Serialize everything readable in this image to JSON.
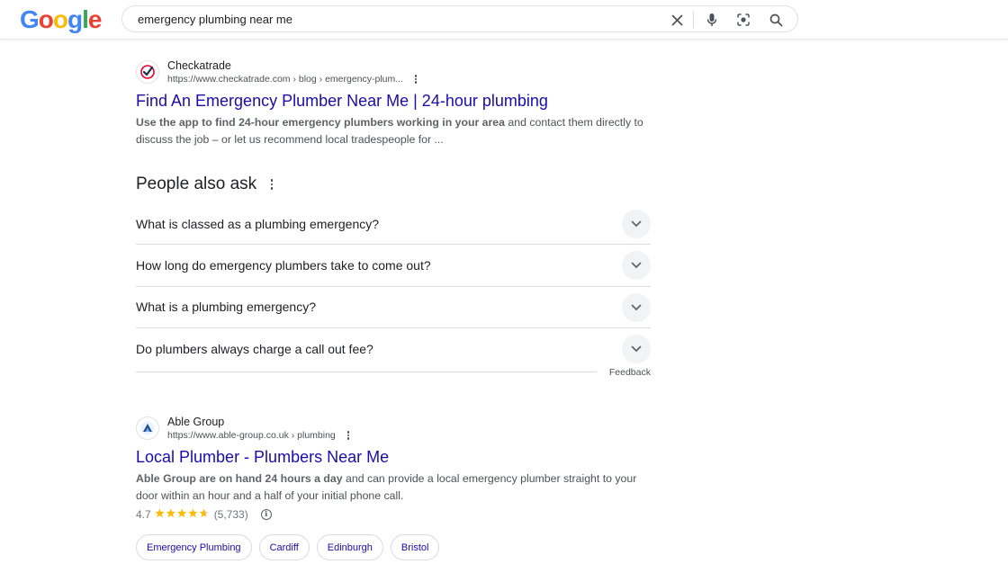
{
  "header": {
    "logo_letters": [
      {
        "ch": "G",
        "color": "#4285F4"
      },
      {
        "ch": "o",
        "color": "#EA4335"
      },
      {
        "ch": "o",
        "color": "#FBBC05"
      },
      {
        "ch": "g",
        "color": "#4285F4"
      },
      {
        "ch": "l",
        "color": "#34A853"
      },
      {
        "ch": "e",
        "color": "#EA4335"
      }
    ],
    "query": "emergency plumbing near me"
  },
  "results": [
    {
      "site_name": "Checkatrade",
      "url": "https://www.checkatrade.com › blog › emergency-plum...",
      "title": "Find An Emergency Plumber Near Me | 24-hour plumbing",
      "snippet_bold": "Use the app to find 24-hour emergency plumbers working in your area",
      "snippet_rest": " and contact them directly to discuss the job – or let us recommend local tradespeople for ..."
    },
    {
      "site_name": "Able Group",
      "url": "https://www.able-group.co.uk › plumbing",
      "title": "Local Plumber - Plumbers Near Me",
      "snippet_bold": "Able Group are on hand 24 hours a day",
      "snippet_rest": " and can provide a local emergency plumber straight to your door within an hour and a half of your initial phone call.",
      "rating": "4.7",
      "rating_fraction": 0.94,
      "rating_count": "(5,733)",
      "chips": [
        "Emergency Plumbing",
        "Cardiff",
        "Edinburgh",
        "Bristol"
      ]
    }
  ],
  "paa": {
    "title": "People also ask",
    "questions": [
      "What is classed as a plumbing emergency?",
      "How long do emergency plumbers take to come out?",
      "What is a plumbing emergency?",
      "Do plumbers always charge a call out fee?"
    ],
    "feedback": "Feedback"
  },
  "colors": {
    "link": "#1a0dab",
    "star": "#fbbc04"
  }
}
